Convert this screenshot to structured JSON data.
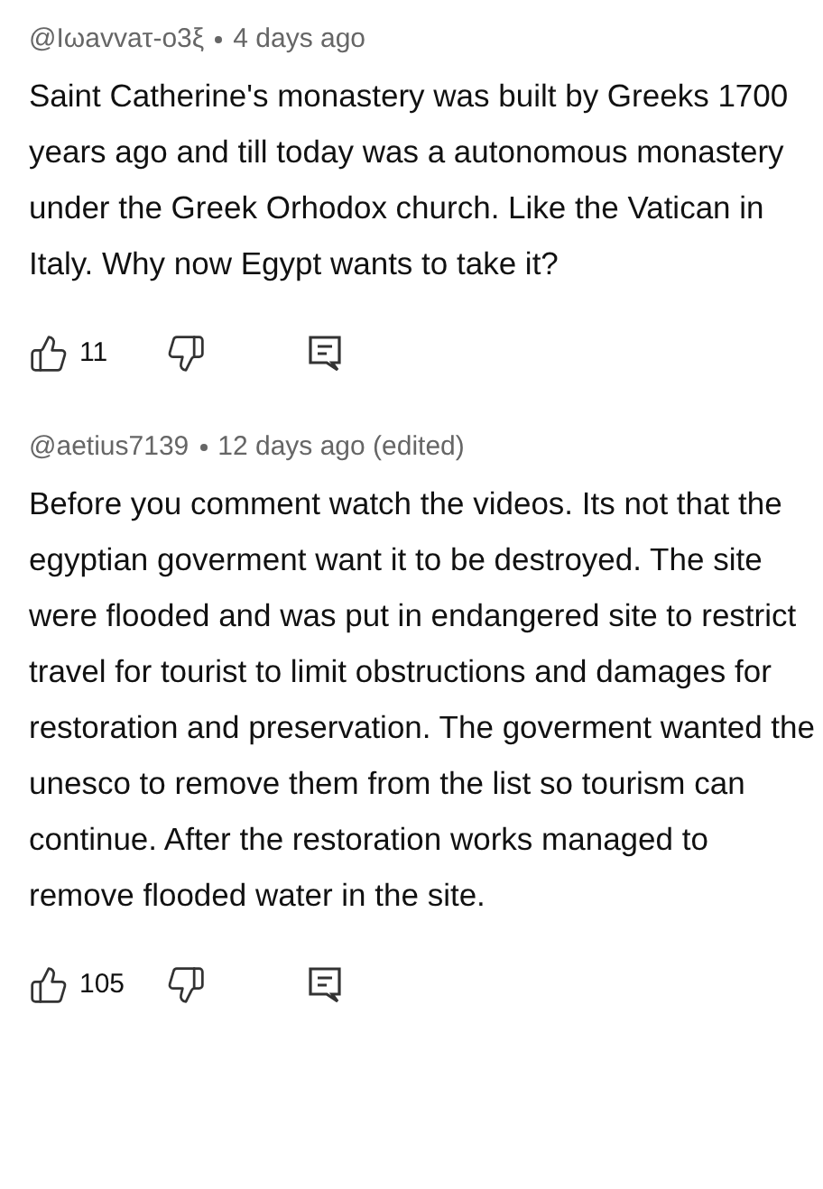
{
  "comments": [
    {
      "author": "@Iωavvaτ-o3ξ",
      "time": "4 days ago",
      "text": "Saint Catherine's monastery was built by Greeks 1700 years ago and till today was a autonomous monastery under the Greek Orhodox church. Like the Vatican in Italy. Why now Egypt wants to take it?",
      "likes": "11"
    },
    {
      "author": "@aetius7139",
      "time": "12 days ago (edited)",
      "text": "Before you comment watch the videos. Its not that the egyptian goverment want it to be destroyed. The site were flooded and was put in endangered site to restrict travel for tourist to limit obstructions and damages for restoration and preservation. The goverment wanted the unesco to remove them from the list so tourism can continue. After the restoration works managed to remove flooded water in the site.",
      "likes": "105"
    }
  ]
}
